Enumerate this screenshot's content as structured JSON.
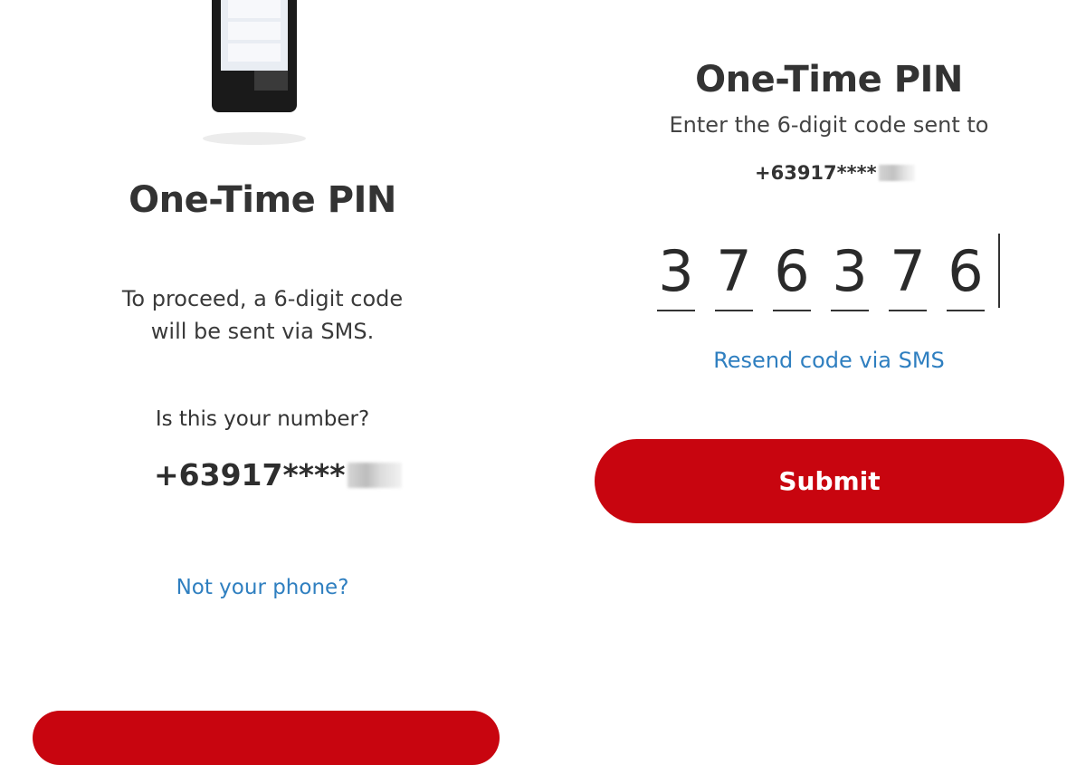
{
  "colors": {
    "brand_red": "#c8050f",
    "link_blue": "#2f7fc0",
    "text_dark": "#333333"
  },
  "left_screen": {
    "illustration": "phone-icon",
    "title": "One-Time PIN",
    "description_line1": "To proceed, a 6-digit code",
    "description_line2": "will be sent via SMS.",
    "question": "Is this your number?",
    "phone_number": "+63917****",
    "not_your_phone_link": "Not your phone?"
  },
  "right_screen": {
    "title": "One-Time PIN",
    "description": "Enter the 6-digit code sent to",
    "phone_number": "+63917****",
    "otp_digits": [
      "3",
      "7",
      "6",
      "3",
      "7",
      "6"
    ],
    "resend_link": "Resend code via SMS",
    "submit_label": "Submit"
  }
}
